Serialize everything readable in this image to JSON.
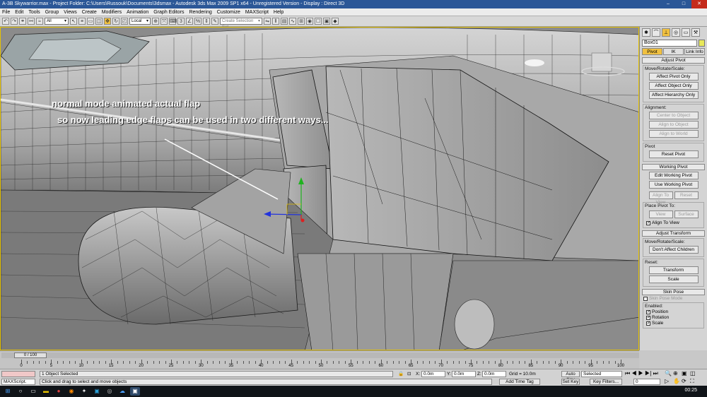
{
  "window": {
    "title": "A-3B Skywarrior.max    - Project Folder: C:\\Users\\Russouk\\Documents\\3dsmax    - Autodesk 3ds Max  2009 SP1  x64   - Unregistered Version     - Display : Direct 3D"
  },
  "menu": [
    "File",
    "Edit",
    "Tools",
    "Group",
    "Views",
    "Create",
    "Modifiers",
    "Animation",
    "Graph Editors",
    "Rendering",
    "Customize",
    "MAXScript",
    "Help"
  ],
  "toolbar": {
    "filter_value": "All",
    "coord_value": "Local",
    "selection_set_placeholder": "Create Selection Set"
  },
  "viewport": {
    "annotation_line1": "normal mode animated actual flap",
    "annotation_line2": "so now leading edge flaps can be used in two different ways..."
  },
  "command_panel": {
    "object_name": "Box01",
    "subtabs": [
      "Pivot",
      "IK",
      "Link Info"
    ],
    "adjust_pivot": {
      "header": "Adjust Pivot",
      "move_group": "Move/Rotate/Scale:",
      "buttons": [
        "Affect Pivot Only",
        "Affect Object Only",
        "Affect Hierarchy Only"
      ],
      "alignment_group": "Alignment:",
      "align_buttons": [
        "Center to Object",
        "Align to Object",
        "Align to World"
      ],
      "pivot_group": "Pivot",
      "reset_pivot": "Reset Pivot"
    },
    "working_pivot": {
      "header": "Working Pivot",
      "edit": "Edit Working Pivot",
      "use": "Use Working Pivot",
      "align_to_view": "Align To View",
      "reset": "Reset",
      "place_group": "Place Pivot To:",
      "view": "View",
      "surface": "Surface",
      "align_to_view_check": "Align To View"
    },
    "adjust_transform": {
      "header": "Adjust Transform",
      "move_group": "Move/Rotate/Scale:",
      "dont_affect": "Don't Affect Children",
      "reset_group": "Reset:",
      "transform": "Transform",
      "scale": "Scale"
    },
    "skin_pose": {
      "header": "Skin Pose",
      "skin_pose_mode": "Skin Pose Mode",
      "enabled_group": "Enabled:",
      "position": "Position",
      "rotation": "Rotation",
      "scale": "Scale"
    }
  },
  "timeline": {
    "frame_counter": "0 / 100",
    "ticks": [
      "0",
      "5",
      "10",
      "15",
      "20",
      "25",
      "30",
      "35",
      "40",
      "45",
      "50",
      "55",
      "60",
      "65",
      "70",
      "75",
      "80",
      "85",
      "90",
      "95",
      "100"
    ]
  },
  "status": {
    "maxscript_label": "MAXScript.",
    "selection_text": "1 Object Selected",
    "prompt_text": "Click and drag to select and move objects",
    "x_label": "X:",
    "x_value": "0.0m",
    "y_label": "Y:",
    "y_value": "0.0m",
    "z_label": "Z:",
    "z_value": "0.0m",
    "grid": "Grid = 10.0m",
    "add_time_tag": "Add Time Tag",
    "auto_key": "Auto Key",
    "selected": "Selected",
    "set_key": "Set Key",
    "key_filters": "Key Filters...",
    "frame_field": "0"
  },
  "taskbar": {
    "clock": "00:25"
  },
  "colors": {
    "title_bg": "#2b5797",
    "viewport_border": "#e6c200",
    "active_tab": "#f0c040",
    "annotation_text": "#ffffff"
  }
}
